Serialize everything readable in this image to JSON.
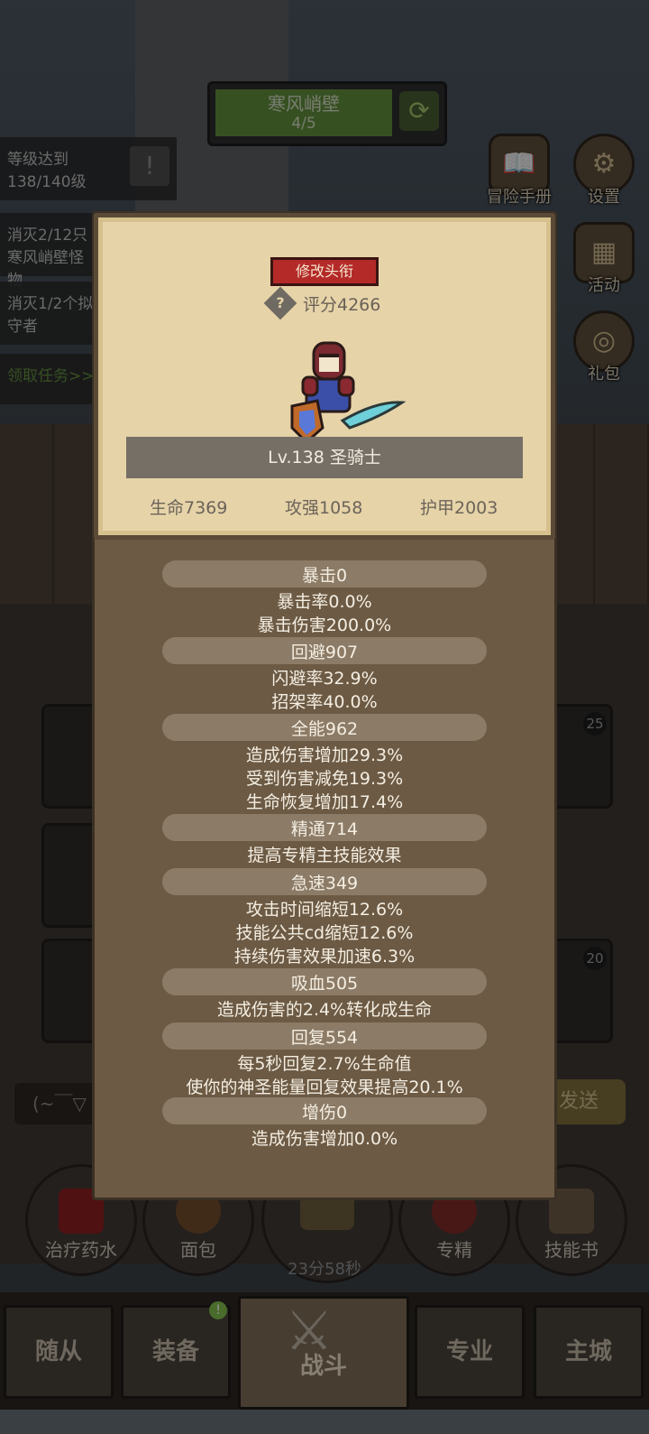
{
  "stage": {
    "name": "寒风峭壁",
    "progress": "4/5"
  },
  "quests": [
    {
      "text": "等级达到138/140级"
    },
    {
      "text": "消灭2/12只寒风峭壁怪物"
    },
    {
      "text": "消灭1/2个拟守者"
    }
  ],
  "quest_link": "领取任务>>",
  "side_buttons": {
    "adventure": "冒险手册",
    "settings": "设置",
    "events": "活动",
    "gift": "礼包"
  },
  "chat": {
    "input": "(~￣▽",
    "send": "发送"
  },
  "bottom_buttons": {
    "potion": "治疗药水",
    "bread": "面包",
    "spec": "专精",
    "skillbook": "技能书"
  },
  "timer": "23分58秒",
  "slot_levels": {
    "a": "25",
    "b": "20"
  },
  "nav": {
    "follower": "随从",
    "equipment": "装备",
    "battle": "战斗",
    "profession": "专业",
    "city": "主城",
    "badge": "!"
  },
  "profile": {
    "change_title": "修改头衔",
    "help": "?",
    "score": "评分4266",
    "level_class": "Lv.138 圣骑士",
    "hp": "生命7369",
    "attack": "攻强1058",
    "armor": "护甲2003"
  },
  "stats": [
    {
      "head": "暴击0",
      "lines": [
        "暴击率0.0%",
        "暴击伤害200.0%"
      ]
    },
    {
      "head": "回避907",
      "lines": [
        "闪避率32.9%",
        "招架率40.0%"
      ]
    },
    {
      "head": "全能962",
      "lines": [
        "造成伤害增加29.3%",
        "受到伤害减免19.3%",
        "生命恢复增加17.4%"
      ]
    },
    {
      "head": "精通714",
      "lines": [
        "提高专精主技能效果"
      ]
    },
    {
      "head": "急速349",
      "lines": [
        "攻击时间缩短12.6%",
        "技能公共cd缩短12.6%",
        "持续伤害效果加速6.3%"
      ]
    },
    {
      "head": "吸血505",
      "lines": [
        "造成伤害的2.4%转化成生命"
      ]
    },
    {
      "head": "回复554",
      "lines": [
        "每5秒回复2.7%生命值",
        "使你的神圣能量回复效果提高20.1%"
      ]
    },
    {
      "head": "增伤0",
      "lines": [
        "造成伤害增加0.0%"
      ]
    }
  ]
}
